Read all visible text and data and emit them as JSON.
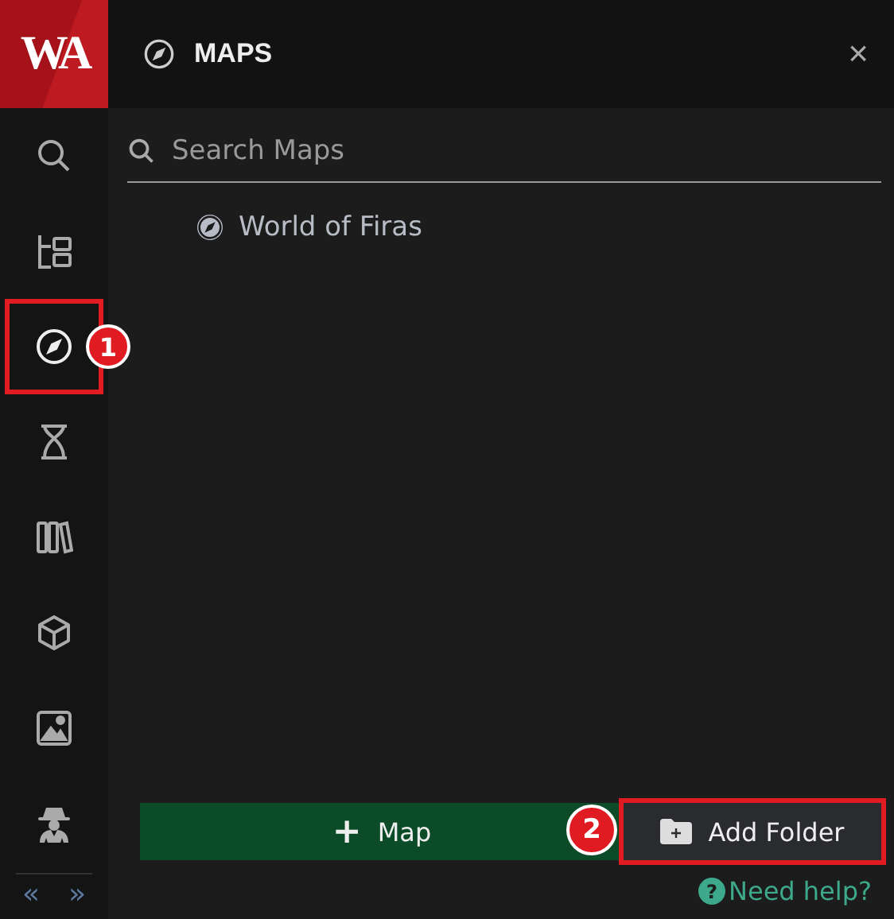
{
  "logo": "WA",
  "rail": [
    {
      "kind": "search",
      "selected": false
    },
    {
      "kind": "tree",
      "selected": false
    },
    {
      "kind": "maps",
      "selected": true,
      "callout": "1"
    },
    {
      "kind": "timeline",
      "selected": false
    },
    {
      "kind": "library",
      "selected": false
    },
    {
      "kind": "object",
      "selected": false
    },
    {
      "kind": "images",
      "selected": false
    },
    {
      "kind": "agent",
      "selected": false
    }
  ],
  "rail_toggle": [
    "«",
    "»"
  ],
  "panel": {
    "title": "MAPS",
    "close": "×"
  },
  "search": {
    "placeholder": "Search Maps"
  },
  "items": [
    {
      "label": "World of Firas"
    }
  ],
  "buttons": [
    {
      "kind": "primary",
      "icon": "+",
      "label": "Map"
    },
    {
      "kind": "secondary",
      "label": "Add Folder",
      "callout": "2"
    }
  ],
  "help": {
    "icon": "?",
    "label": "Need help?"
  }
}
